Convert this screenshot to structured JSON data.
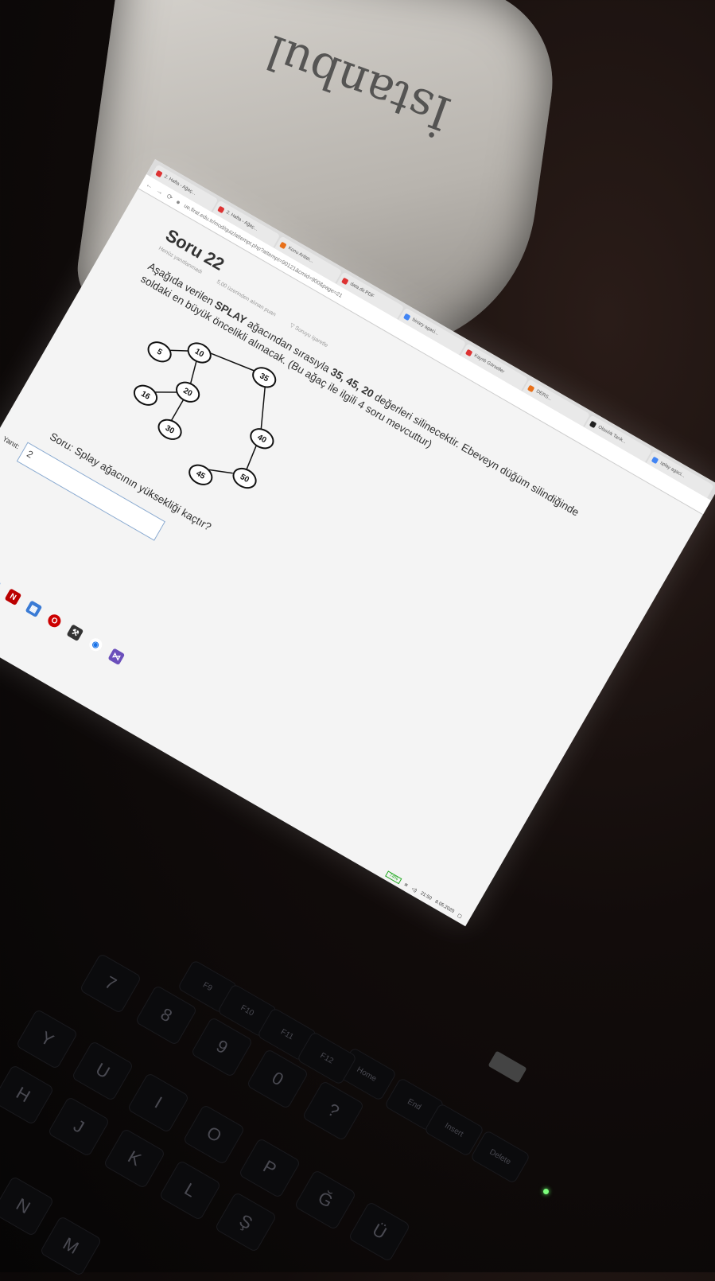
{
  "background": {
    "cloth_text": "İstanbul"
  },
  "browser": {
    "tabs": [
      {
        "label": "2. Hafta - Ağaç..."
      },
      {
        "label": "2. Hafta - Ağaç..."
      },
      {
        "label": "Konu Anlatı..."
      },
      {
        "label": "data.dir.PDF"
      },
      {
        "label": "binary agaci..."
      },
      {
        "label": "Kayıtlı Görseller"
      },
      {
        "label": "DERS..."
      },
      {
        "label": "Olasılık Tarık..."
      },
      {
        "label": "splay agaci..."
      }
    ],
    "url": "ue.firat.edu.tr/mod/quiz/attempt.php?attempt=90121&cmid=900&page=21"
  },
  "question": {
    "title": "Soru 22",
    "status": "Henüz yanıtlanmadı",
    "points": "5,00 üzerinden alınan puan",
    "flag": "Soruyu işaretle",
    "text_before": "Aşağıda verilen ",
    "bold_term": "SPLAY",
    "text_middle": " ağacından sırasıyla ",
    "bold_values": "35, 45, 20",
    "text_after": " değerleri silinecektir. Ebeveyn düğüm silindiğinde soldaki en büyük öncelikli alınacak. (Bu ağaç ile ilgili 4 soru mevcuttur)",
    "subquestion": "Soru: Splay ağacının yüksekliği kaçtır?",
    "answer_label": "Yanıt:",
    "answer_value": "2"
  },
  "tree_nodes": [
    {
      "id": "n35",
      "label": "35"
    },
    {
      "id": "n10",
      "label": "10"
    },
    {
      "id": "n40",
      "label": "40"
    },
    {
      "id": "n5",
      "label": "5"
    },
    {
      "id": "n20",
      "label": "20"
    },
    {
      "id": "n50",
      "label": "50"
    },
    {
      "id": "n16",
      "label": "16"
    },
    {
      "id": "n30",
      "label": "30"
    },
    {
      "id": "n45",
      "label": "45"
    }
  ],
  "tray": {
    "battery": "74%",
    "time": "21:50",
    "date": "8.05.2020"
  },
  "keyboard": {
    "keys": [
      "Y",
      "U",
      "I",
      "O",
      "P",
      "Ğ",
      "Ü",
      "H",
      "J",
      "K",
      "L",
      "Ş",
      "N",
      "M",
      "7",
      "8",
      "9",
      "0",
      "?",
      "Home",
      "End",
      "Insert",
      "Delete",
      "F9",
      "F10",
      "F11",
      "F12"
    ]
  },
  "colors": {
    "screen_bg": "#f4f4f4",
    "input_border": "#8aaad0",
    "led": "#7dff7d"
  }
}
